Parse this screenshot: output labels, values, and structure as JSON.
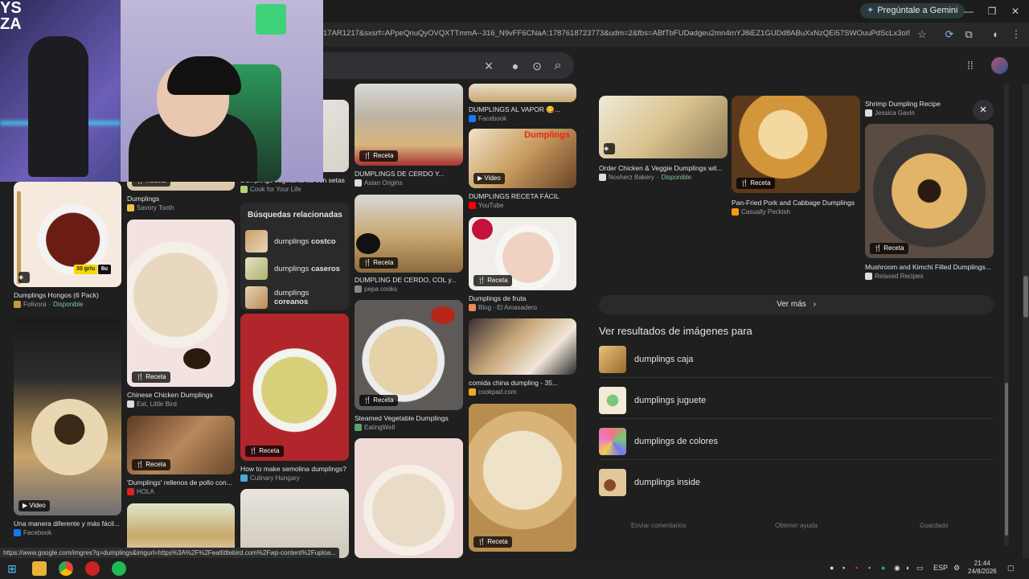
{
  "browser": {
    "gemini_button": "Pregúntale a Gemini",
    "url": "17AR1217&sxsrf=APpeQnuQyOVQXTTmmA--316_N9vFF6CNaA:1787618723773&udm=2&fbs=ABfTbFUDadgeu2mn4mYJ8iEZ1GUDd8ABuXxNzQEi57SWOuuPdScLx3oI9c1cFkIj..."
  },
  "icons": {
    "clear": "×",
    "mic": "🎤",
    "lens": "⊙",
    "search": "⌕",
    "apps": "⋮⋮",
    "close": "×",
    "chevron": "›",
    "star": "☆",
    "ext": "⧉",
    "menu": "⋮",
    "minimize": "—",
    "restore": "❐",
    "winclose": "✕",
    "recipe": "🍴",
    "video": "▶",
    "windows": "⊞"
  },
  "grid": {
    "col1": [
      {
        "title": "Dumplings Hongos (6 Pack)",
        "source": "Folivora",
        "available": "Disponible",
        "badge_price": "30 gr/u"
      },
      {
        "title": "Una manera diferente y más fácil...",
        "source": "Facebook",
        "badge": "Video"
      }
    ],
    "col2": [
      {
        "title": "Dumplings",
        "source": "Savory Tooth",
        "badge": "Receta"
      },
      {
        "title": "Chinese Chicken Dumplings",
        "source": "Eat, Little Bird",
        "badge": "Receta"
      },
      {
        "title": "'Dumplings' rellenos de pollo con...",
        "source": "HOLA",
        "badge": "Receta"
      }
    ],
    "col3": [
      {
        "title": "Dumplings vegetarianos con setas",
        "source": "Cook for Your Life"
      },
      {
        "title": "How to make semolina dumplings?",
        "source": "Culinary Hungary",
        "badge": "Receta"
      }
    ],
    "col4": [
      {
        "title": "DUMPLINGS DE CERDO Y...",
        "source": "Asian Origins",
        "badge": "Receta"
      },
      {
        "title": "DUMPLING DE CERDO, COL y...",
        "source": "pepa cooks",
        "badge": "Receta"
      },
      {
        "title": "Steamed Vegetable Dumplings",
        "source": "EatingWell",
        "badge": "Receta"
      }
    ],
    "col5": [
      {
        "title": "DUMPLINGS AL VAPOR 😋...",
        "source": "Facebook"
      },
      {
        "title": "DUMPLINGS RECETA FÁCIL",
        "source": "YouTube",
        "badge": "Video",
        "overlay": "Dumplings"
      },
      {
        "title": "Dumplings de fruta",
        "source": "Blog - El Amasadero",
        "badge": "Receta"
      },
      {
        "title": "comida china dumpling - 35...",
        "source": "cookpad.com"
      },
      {
        "badge": "Receta"
      }
    ]
  },
  "related": {
    "title": "Búsquedas relacionadas",
    "items": [
      {
        "prefix": "dumplings",
        "bold": "costco"
      },
      {
        "prefix": "dumplings",
        "bold": "caseros"
      },
      {
        "prefix": "dumplings",
        "bold": "coreanos"
      }
    ]
  },
  "panel": {
    "cards": [
      {
        "title": "Order Chicken & Veggie Dumplings wit...",
        "source": "Nosherz Bakery",
        "available": "Disponible"
      },
      {
        "title": "Pan-Fried Pork and Cabbage Dumplings",
        "source": "Casually Peckish",
        "badge": "Receta"
      },
      {
        "title": "Shrimp Dumpling Recipe",
        "source": "Jessica Gavin"
      },
      {
        "title": "Mushroom and Kimchi Filled Dumplings...",
        "source": "Relaxed Recipes",
        "badge": "Receta"
      }
    ],
    "ver_mas": "Ver más",
    "ver_resultados_title": "Ver resultados de imágenes para",
    "results": [
      {
        "label": "dumplings caja"
      },
      {
        "label": "dumplings juguete"
      },
      {
        "label": "dumplings de colores"
      },
      {
        "label": "dumplings inside"
      }
    ],
    "footer": [
      "Enviar comentarios",
      "Obtener ayuda",
      "Guardado"
    ]
  },
  "status_url": "https://www.google.com/imgres?q=dumplings&imgurl=https%3A%2F%2Featlittlebird.com%2Fwp-content%2Fuploa...",
  "taskbar": {
    "lang": "ESP",
    "time": "21:44",
    "date": "24/8/2026"
  }
}
